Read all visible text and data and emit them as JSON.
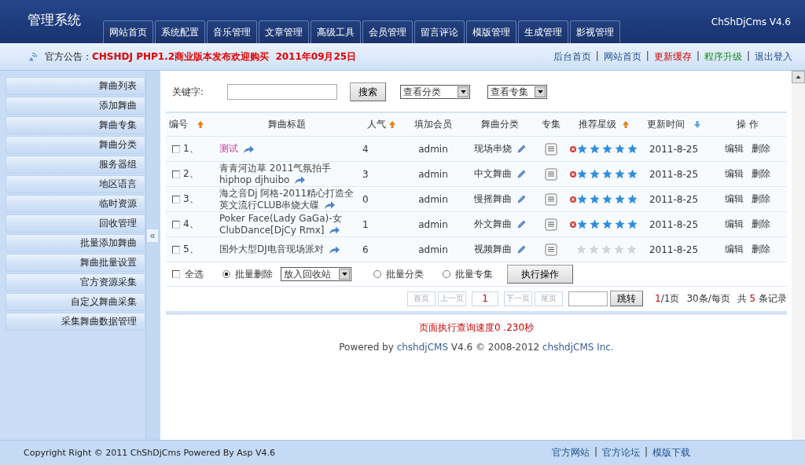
{
  "header": {
    "title": "管理系统",
    "version": "ChShDjCms V4.6",
    "tabs": [
      {
        "label": "网站首页",
        "selected": false
      },
      {
        "label": "系统配置",
        "selected": false
      },
      {
        "label": "音乐管理",
        "selected": false
      },
      {
        "label": "文章管理",
        "selected": false
      },
      {
        "label": "高级工具",
        "selected": false
      },
      {
        "label": "会员管理",
        "selected": false
      },
      {
        "label": "留言评论",
        "selected": false
      },
      {
        "label": "模版管理",
        "selected": false
      },
      {
        "label": "生成管理",
        "selected": false
      },
      {
        "label": "影视管理",
        "selected": false
      }
    ]
  },
  "notice": {
    "label": "官方公告：",
    "text": "CHSHDJ PHP1.2商业版本发布欢迎购买  2011年09月25日",
    "separator": "|",
    "links": [
      {
        "label": "后台首页",
        "kind": "normal"
      },
      {
        "label": "网站首页",
        "kind": "normal"
      },
      {
        "label": "更新缓存",
        "kind": "alert"
      },
      {
        "label": "程序升级",
        "kind": "success"
      },
      {
        "label": "退出登入",
        "kind": "normal"
      }
    ]
  },
  "sidebar": {
    "items": [
      "舞曲列表",
      "添加舞曲",
      "舞曲专集",
      "舞曲分类",
      "服务器组",
      "地区语言",
      "临时资源",
      "回收管理",
      "批量添加舞曲",
      "舞曲批量设置",
      "官方资源采集",
      "自定义舞曲采集",
      "采集舞曲数据管理"
    ],
    "collapse": "«"
  },
  "search": {
    "label": "关键字:",
    "button": "搜索",
    "selects": [
      "查看分类",
      "查看专集"
    ]
  },
  "table": {
    "columns": [
      {
        "label": "编号",
        "kind": "sort-up"
      },
      {
        "label": "舞曲标题",
        "kind": "plain"
      },
      {
        "label": "人气",
        "kind": "sort-up"
      },
      {
        "label": "填加会员",
        "kind": "plain"
      },
      {
        "label": "舞曲分类",
        "kind": "plain"
      },
      {
        "label": "专集",
        "kind": "plain"
      },
      {
        "label": "推荐星级",
        "kind": "sort-up"
      },
      {
        "label": "更新时间",
        "kind": "sort-down"
      },
      {
        "label": "操 作",
        "kind": "plain"
      }
    ],
    "rows": [
      {
        "checked": false,
        "no": "1、",
        "title": "测试",
        "highlighted": true,
        "hits": "4",
        "member": "admin",
        "category": "现场串烧",
        "stars": 5,
        "date": "2011-8-25",
        "actions": [
          "编辑",
          "删除"
        ]
      },
      {
        "checked": false,
        "no": "2、",
        "title": "青青河边草  2011气氛拍手hiphop djhuibo",
        "highlighted": false,
        "hits": "3",
        "member": "admin",
        "category": "中文舞曲",
        "stars": 5,
        "date": "2011-8-25",
        "actions": [
          "编辑",
          "删除"
        ]
      },
      {
        "checked": false,
        "no": "3、",
        "title": "海之音Dj 阿格-2011精心打造全英文流行CLUB串烧大碟",
        "highlighted": false,
        "hits": "0",
        "member": "admin",
        "category": "慢摇舞曲",
        "stars": 5,
        "date": "2011-8-25",
        "actions": [
          "编辑",
          "删除"
        ]
      },
      {
        "checked": false,
        "no": "4、",
        "title": "Poker Face(Lady GaGa)-女ClubDance[DjCy Rmx]",
        "highlighted": false,
        "hits": "1",
        "member": "admin",
        "category": "外文舞曲",
        "stars": 5,
        "date": "2011-8-25",
        "actions": [
          "编辑",
          "删除"
        ]
      },
      {
        "checked": false,
        "no": "5、",
        "title": "国外大型DJ电音现场派对",
        "highlighted": false,
        "hits": "6",
        "member": "admin",
        "category": "视频舞曲",
        "stars": 0,
        "date": "2011-8-25",
        "actions": [
          "编辑",
          "删除"
        ]
      }
    ]
  },
  "batch": {
    "select_all": {
      "label": "全选",
      "checked": false
    },
    "options": [
      {
        "label": "批量删除",
        "selected": true,
        "select": "放入回收站"
      },
      {
        "label": "批量分类",
        "selected": false
      },
      {
        "label": "批量专集",
        "selected": false
      }
    ],
    "button": "执行操作"
  },
  "pager": {
    "buttons": [
      {
        "label": "首页",
        "disabled": true,
        "selected": false
      },
      {
        "label": "上一页",
        "disabled": true,
        "selected": false
      },
      {
        "label": "1",
        "disabled": false,
        "selected": true
      },
      {
        "label": "下一页",
        "disabled": true,
        "selected": false
      },
      {
        "label": "尾页",
        "disabled": true,
        "selected": false
      }
    ],
    "jump": "跳转",
    "current": "1",
    "of_total": "/1页",
    "per_page": "30条/每页",
    "count_prefix": "共",
    "count": "5",
    "count_suffix": "条记录"
  },
  "speed": "页面执行查询速度0 .230秒",
  "powered": {
    "prefix": "Powered by ",
    "brand": "chshdjCMS",
    "middle": " V4.6 © 2008-2012  ",
    "company": "chshdjCMS Inc."
  },
  "footer": {
    "copyright": "Copyright Right © 2011 ChShDjCms Powered By Asp V4.6",
    "separator": "|",
    "links": [
      "官方网站",
      "官方论坛",
      "模版下载"
    ]
  }
}
